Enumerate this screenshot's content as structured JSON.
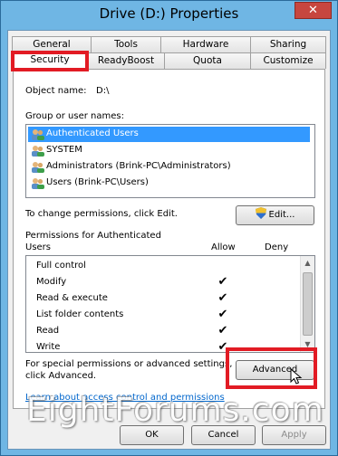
{
  "window": {
    "title": "Drive (D:) Properties",
    "close_glyph": "✕"
  },
  "tabs_row1": [
    "General",
    "Tools",
    "Hardware",
    "Sharing"
  ],
  "tabs_row2": [
    "Security",
    "ReadyBoost",
    "Quota",
    "Customize"
  ],
  "object": {
    "label": "Object name:",
    "value": "D:\\"
  },
  "groups": {
    "label": "Group or user names:",
    "items": [
      "Authenticated Users",
      "SYSTEM",
      "Administrators (Brink-PC\\Administrators)",
      "Users (Brink-PC\\Users)"
    ]
  },
  "change_hint": "To change permissions, click Edit.",
  "edit_label": "Edit...",
  "perms": {
    "title_line1": "Permissions for Authenticated",
    "title_line2": "Users",
    "allow_header": "Allow",
    "deny_header": "Deny",
    "rows": [
      {
        "name": "Full control",
        "allow": ""
      },
      {
        "name": "Modify",
        "allow": "✔"
      },
      {
        "name": "Read & execute",
        "allow": "✔"
      },
      {
        "name": "List folder contents",
        "allow": "✔"
      },
      {
        "name": "Read",
        "allow": "✔"
      },
      {
        "name": "Write",
        "allow": "✔"
      }
    ]
  },
  "special": {
    "line1": "For special permissions or advanced settings,",
    "line2": "click Advanced."
  },
  "advanced_label": "Advanced",
  "learn_link": "Learn about access control and permissions",
  "buttons": {
    "ok": "OK",
    "cancel": "Cancel",
    "apply": "Apply"
  },
  "watermark": "EightForums.com",
  "colors": {
    "accent": "#3399ff",
    "highlight": "#e21b24",
    "frame": "#6fb6e4"
  }
}
